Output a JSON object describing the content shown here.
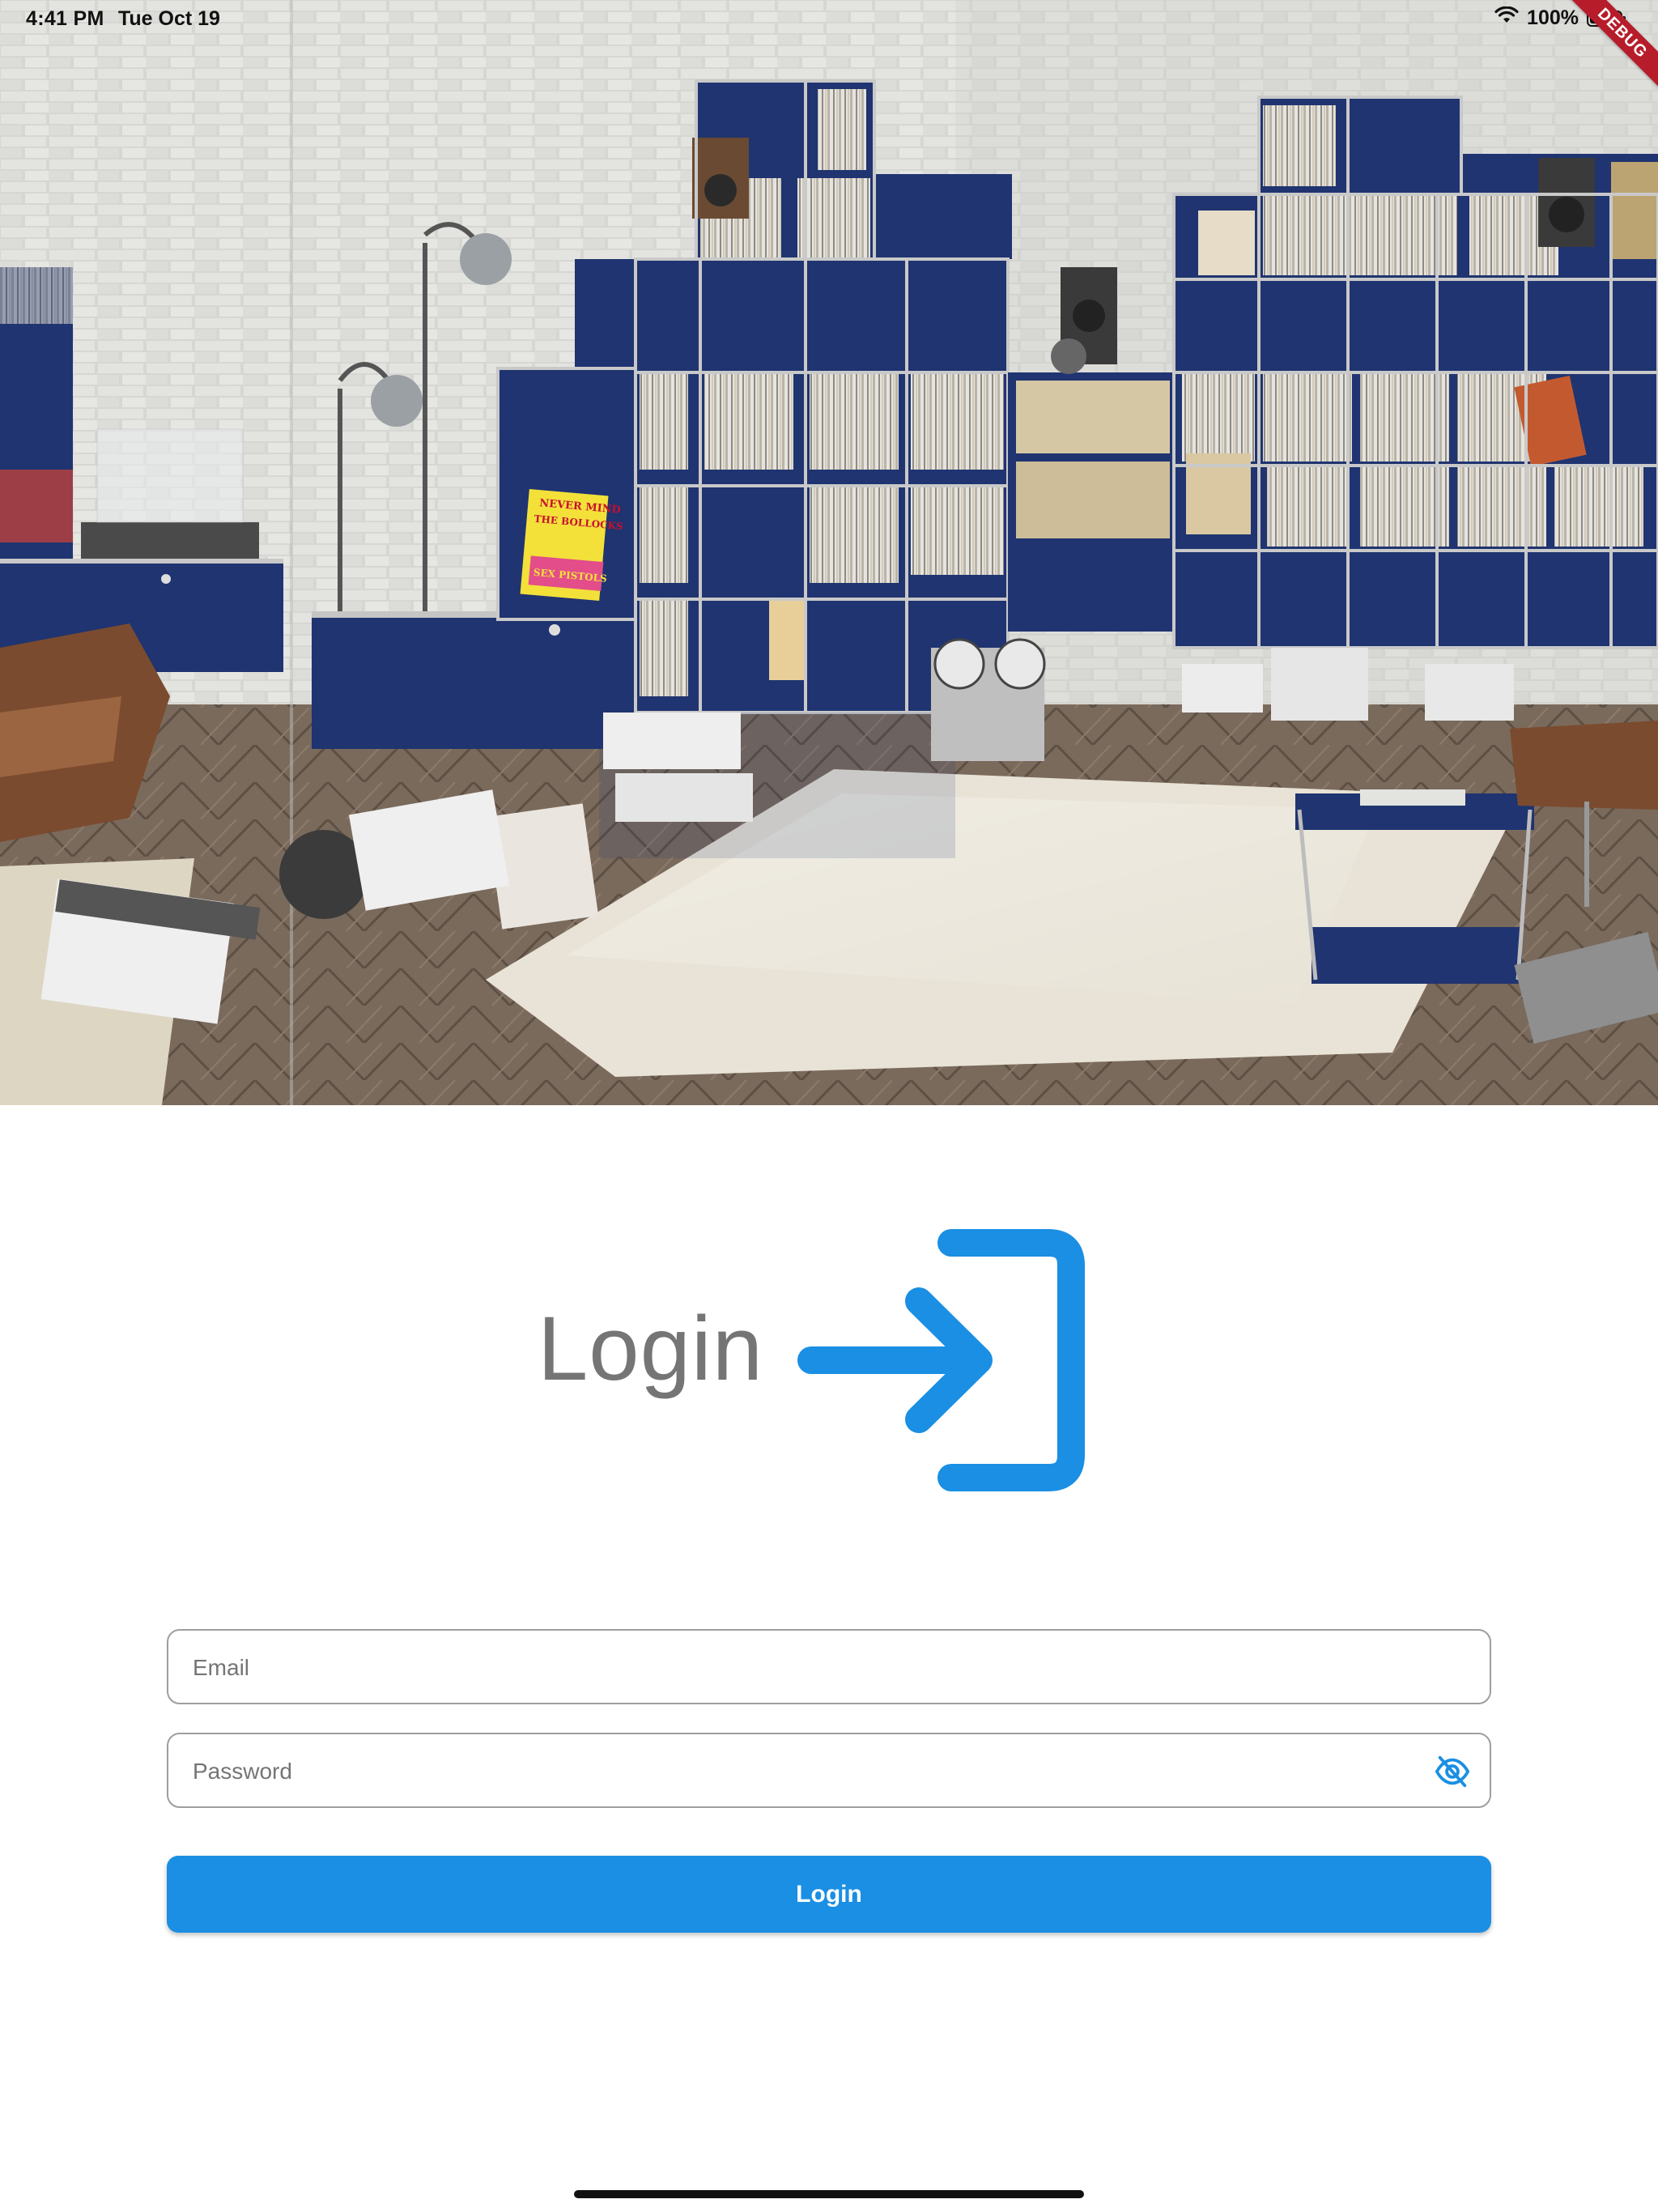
{
  "status_bar": {
    "time": "4:41 PM",
    "date": "Tue Oct 19",
    "battery": "100%",
    "icons": [
      "wifi-icon",
      "battery-icon"
    ]
  },
  "debug_banner": "DEBUG",
  "hero": {
    "album_cover_line1": "NEVER MIND",
    "album_cover_line2": "THE BOLLOCKS",
    "album_cover_line3": "SEX PISTOLS"
  },
  "login": {
    "title": "Login",
    "icon": "login-icon"
  },
  "form": {
    "email_placeholder": "Email",
    "password_placeholder": "Password",
    "password_toggle_icon": "eye-off-icon",
    "submit_label": "Login"
  },
  "colors": {
    "accent": "#1a8fe3",
    "title_gray": "#757575",
    "border_gray": "#9e9e9e",
    "cabinet_blue": "#1f3470"
  }
}
